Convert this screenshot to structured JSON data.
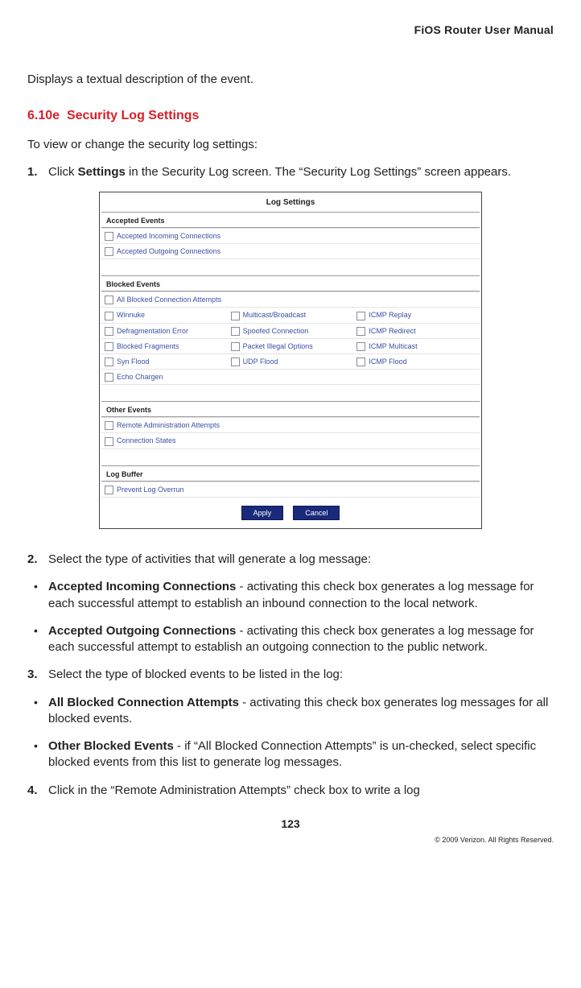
{
  "header": {
    "title": "FiOS Router User Manual"
  },
  "intro_para": "Displays a textual description of the event.",
  "section": {
    "number": "6.10e",
    "title": "Security Log Settings",
    "intro": "To view or change the security log settings:"
  },
  "steps": {
    "s1": {
      "num": "1.",
      "prefix": "Click ",
      "bold": "Settings",
      "suffix": " in the Security Log screen. The “Security Log Settings” screen appears."
    },
    "s2": {
      "num": "2.",
      "text": "Select the type of activities that will generate a log message:"
    },
    "s3": {
      "num": "3.",
      "text": "Select the type of blocked events to be listed in the log:"
    },
    "s4": {
      "num": "4.",
      "text": "Click in the “Remote Administration Attempts” check box to write a log"
    }
  },
  "bulletsA": {
    "b1": {
      "bold": "Accepted Incoming Connections",
      "text": " - activating this check box generates a log message for each successful attempt to establish an inbound connection to the local network."
    },
    "b2": {
      "bold": "Accepted Outgoing Connections",
      "text": " - activating this check box generates a log message for each successful attempt to establish an outgoing connection to the public network."
    }
  },
  "bulletsB": {
    "b1": {
      "bold": "All Blocked Connection Attempts",
      "text": " - activating this check box generates log messages for all blocked events."
    },
    "b2": {
      "bold": "Other Blocked Events",
      "text": " - if “All Blocked Connection Attempts” is un-checked, select specific blocked events from this list to generate log messages."
    }
  },
  "figure": {
    "title": "Log Settings",
    "accepted_hdr": "Accepted Events",
    "accepted": {
      "a1": "Accepted Incoming Connections",
      "a2": "Accepted Outgoing Connections"
    },
    "blocked_hdr": "Blocked Events",
    "blocked_top": "All Blocked Connection Attempts",
    "blocked": {
      "r1c1": "Winnuke",
      "r1c2": "Multicast/Broadcast",
      "r1c3": "ICMP Replay",
      "r2c1": "Defragmentation Error",
      "r2c2": "Spoofed Connection",
      "r2c3": "ICMP Redirect",
      "r3c1": "Blocked Fragments",
      "r3c2": "Packet Illegal Options",
      "r3c3": "ICMP Multicast",
      "r4c1": "Syn Flood",
      "r4c2": "UDP Flood",
      "r4c3": "ICMP Flood",
      "r5c1": "Echo Chargen"
    },
    "other_hdr": "Other Events",
    "other": {
      "o1": "Remote Administration Attempts",
      "o2": "Connection States"
    },
    "buffer_hdr": "Log Buffer",
    "buffer": {
      "p1": "Prevent Log Overrun"
    },
    "btn_apply": "Apply",
    "btn_cancel": "Cancel"
  },
  "footer": {
    "page": "123",
    "copyright": "© 2009 Verizon. All Rights Reserved."
  }
}
